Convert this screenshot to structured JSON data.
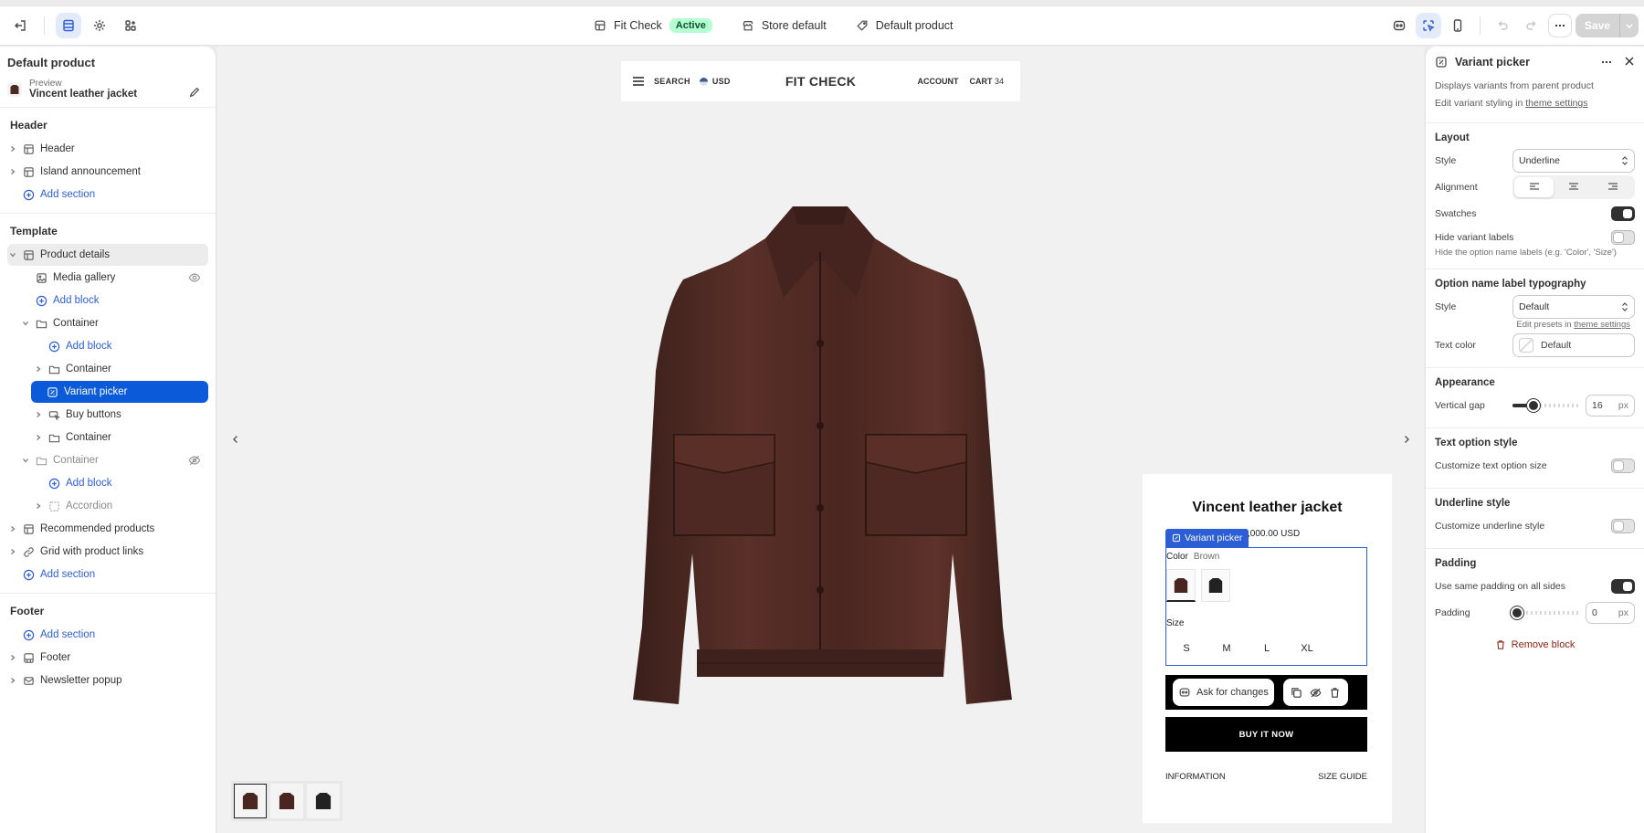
{
  "topbar": {
    "theme_name": "Fit Check",
    "theme_status": "Active",
    "store": "Store default",
    "template": "Default product",
    "save_label": "Save"
  },
  "left": {
    "title": "Default product",
    "preview_label": "Preview",
    "preview_value": "Vincent leather jacket",
    "header_group": "Header",
    "header_items": [
      "Header",
      "Island announcement"
    ],
    "template_group": "Template",
    "footer_group": "Footer",
    "footer_items": [
      "Footer",
      "Newsletter popup"
    ],
    "labels": {
      "add_section": "Add section",
      "add_block": "Add block",
      "product_details": "Product details",
      "media_gallery": "Media gallery",
      "container": "Container",
      "variant_picker": "Variant picker",
      "buy_buttons": "Buy buttons",
      "accordion": "Accordion",
      "recommended": "Recommended products",
      "grid_links": "Grid with product links"
    }
  },
  "store": {
    "search": "SEARCH",
    "currency": "USD",
    "title": "FIT CHECK",
    "account": "ACCOUNT",
    "cart": "CART",
    "cart_count": "34",
    "product_name": "Vincent leather jacket",
    "price": ",000.00 USD",
    "variant_tag": "Variant picker",
    "color_label": "Color",
    "color_value": "Brown",
    "size_label": "Size",
    "sizes": [
      "S",
      "M",
      "L",
      "XL"
    ],
    "ask_label": "Ask for changes",
    "buy_now": "BUY IT NOW",
    "information": "INFORMATION",
    "size_guide": "SIZE GUIDE"
  },
  "right": {
    "title": "Variant picker",
    "desc1": "Displays variants from parent product",
    "desc2_prefix": "Edit variant styling in ",
    "desc2_link": "theme settings",
    "layout_title": "Layout",
    "style_label": "Style",
    "style_value": "Underline",
    "alignment_label": "Alignment",
    "swatches_label": "Swatches",
    "hide_labels_label": "Hide variant labels",
    "hide_labels_hint": "Hide the option name labels (e.g. 'Color', 'Size')",
    "typo_title": "Option name label typography",
    "typo_style_label": "Style",
    "typo_style_value": "Default",
    "presets_prefix": "Edit presets in ",
    "presets_link": "theme settings",
    "text_color_label": "Text color",
    "text_color_value": "Default",
    "appearance_title": "Appearance",
    "gap_label": "Vertical gap",
    "gap_value": "16",
    "unit": "px",
    "text_option_title": "Text option style",
    "text_option_label": "Customize text option size",
    "underline_title": "Underline style",
    "underline_label": "Customize underline style",
    "padding_title": "Padding",
    "same_padding_label": "Use same padding on all sides",
    "padding_label": "Padding",
    "padding_value": "0",
    "remove_label": "Remove block"
  }
}
